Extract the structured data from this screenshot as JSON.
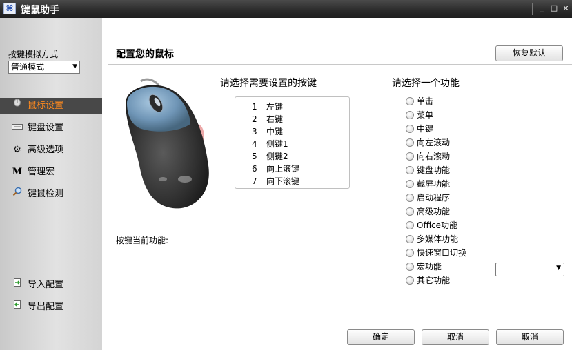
{
  "window": {
    "title": "键鼠助手",
    "app_icon": "keyboard-mouse-icon",
    "controls": {
      "minimize": "_",
      "maximize": "□",
      "close": "×"
    }
  },
  "sidebar": {
    "mode_label": "按键模拟方式",
    "mode_value": "普通模式",
    "nav_items": [
      {
        "label": "鼠标设置",
        "icon": "mouse-icon",
        "active": true
      },
      {
        "label": "键盘设置",
        "icon": "keyboard-icon",
        "active": false
      },
      {
        "label": "高级选项",
        "icon": "gear-icon",
        "active": false
      },
      {
        "label": "管理宏",
        "icon": "macro-m-icon",
        "active": false
      },
      {
        "label": "键鼠检测",
        "icon": "magnifier-icon",
        "active": false
      }
    ],
    "bottom_items": [
      {
        "label": "导入配置",
        "icon": "import-icon"
      },
      {
        "label": "导出配置",
        "icon": "export-icon"
      }
    ]
  },
  "main": {
    "title": "配置您的鼠标",
    "restore_default_label": "恢复默认",
    "select_key_heading": "请选择需要设置的按键",
    "keys": [
      {
        "num": "1",
        "name": "左键"
      },
      {
        "num": "2",
        "name": "右键"
      },
      {
        "num": "3",
        "name": "中键"
      },
      {
        "num": "4",
        "name": "侧键1"
      },
      {
        "num": "5",
        "name": "侧键2"
      },
      {
        "num": "6",
        "name": "向上滚键"
      },
      {
        "num": "7",
        "name": "向下滚键"
      }
    ],
    "current_function_label": "按键当前功能:",
    "select_function_heading": "请选择一个功能",
    "functions": [
      "单击",
      "菜单",
      "中键",
      "向左滚动",
      "向右滚动",
      "键盘功能",
      "截屏功能",
      "启动程序",
      "高级功能",
      "Office功能",
      "多媒体功能",
      "快速窗口切换",
      "宏功能",
      "其它功能"
    ],
    "function_select_value": "",
    "buttons": {
      "ok": "确定",
      "cancel1": "取消",
      "cancel2": "取消"
    }
  },
  "colors": {
    "active_nav_text": "#ff8a1e",
    "active_nav_bg": "#484848",
    "titlebar": "#2a2a2a"
  }
}
